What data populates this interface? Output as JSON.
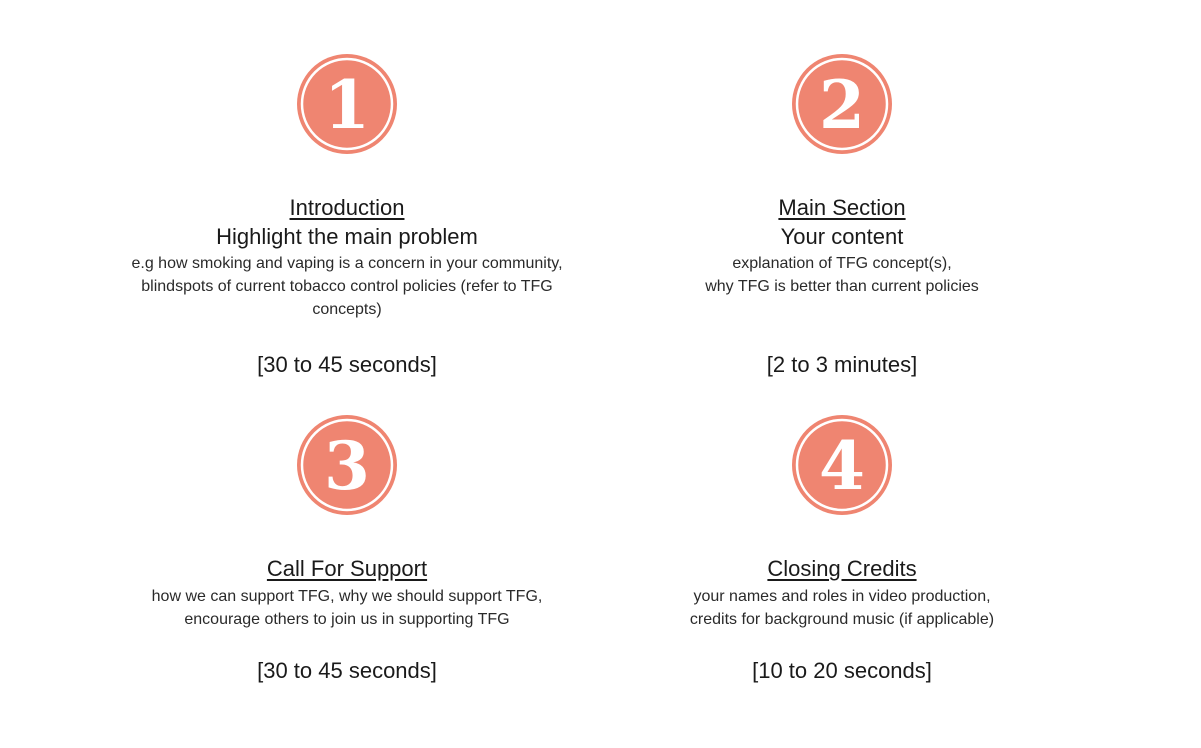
{
  "colors": {
    "badge_fill": "#ef8571",
    "badge_ring": "#ffffff",
    "text": "#1a1a1a"
  },
  "sections": [
    {
      "number": "1",
      "heading": "Introduction",
      "subheading": "Highlight the main problem",
      "description_lines": [
        "e.g how smoking and vaping is a concern in your community,",
        "blindspots of current tobacco control policies (refer to TFG",
        "concepts)"
      ],
      "duration": "[30 to 45 seconds]"
    },
    {
      "number": "2",
      "heading": "Main Section",
      "subheading": "Your content",
      "description_lines": [
        "explanation of TFG concept(s),",
        "why TFG is better than current policies"
      ],
      "duration": "[2 to 3 minutes]"
    },
    {
      "number": "3",
      "heading": "Call For Support",
      "description_lines": [
        "how we can support TFG, why we should support TFG,",
        "encourage others to join us in supporting TFG"
      ],
      "duration": "[30 to 45 seconds]"
    },
    {
      "number": "4",
      "heading": "Closing Credits",
      "description_lines": [
        "your names and roles in video production,",
        "credits for background music (if applicable)"
      ],
      "duration": "[10 to 20 seconds]"
    }
  ]
}
